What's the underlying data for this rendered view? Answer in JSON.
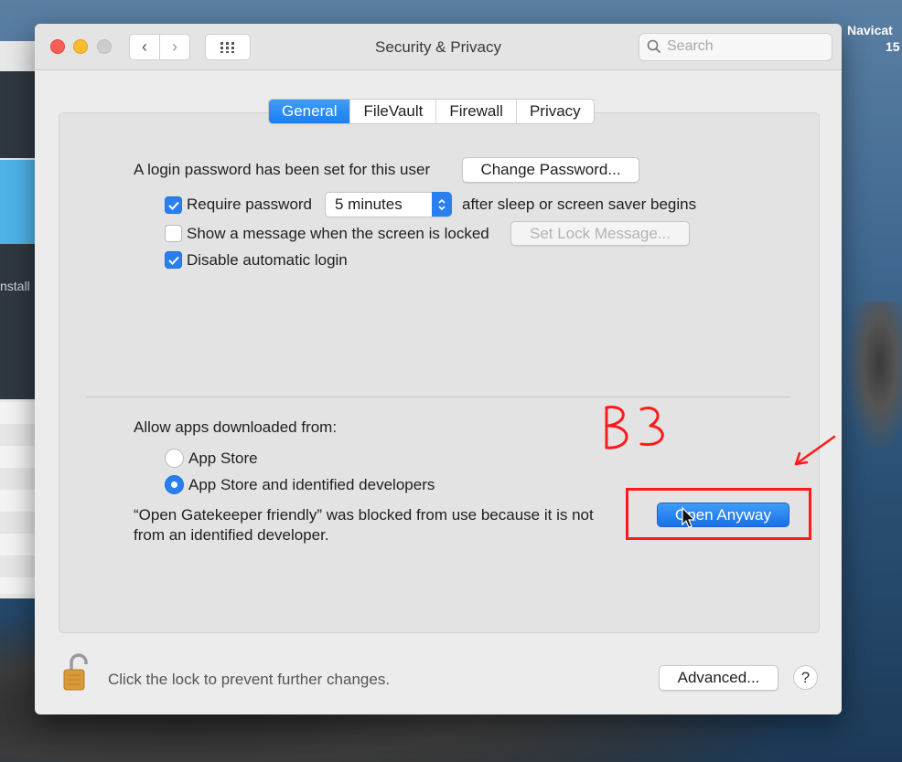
{
  "desktop": {
    "side_app_label": "nstall",
    "navicat_label": "Navicat",
    "navicat_number": "15"
  },
  "window": {
    "title": "Security & Privacy",
    "search_placeholder": "Search"
  },
  "tabs": [
    {
      "label": "General",
      "active": true
    },
    {
      "label": "FileVault",
      "active": false
    },
    {
      "label": "Firewall",
      "active": false
    },
    {
      "label": "Privacy",
      "active": false
    }
  ],
  "general": {
    "login_password_text": "A login password has been set for this user",
    "change_password_button": "Change Password...",
    "require_password_label": "Require password",
    "require_password_checked": true,
    "require_password_delay": "5 minutes",
    "after_sleep_text": "after sleep or screen saver begins",
    "show_message_label": "Show a message when the screen is locked",
    "show_message_checked": false,
    "set_lock_message_button": "Set Lock Message...",
    "disable_auto_login_label": "Disable automatic login",
    "disable_auto_login_checked": true
  },
  "gatekeeper": {
    "allow_apps_label": "Allow apps downloaded from:",
    "options": [
      {
        "label": "App Store",
        "selected": false
      },
      {
        "label": "App Store and identified developers",
        "selected": true
      }
    ],
    "blocked_message_line1": "“Open Gatekeeper friendly” was blocked from use because it is not",
    "blocked_message_line2": "from an identified developer.",
    "open_anyway_button": "Open Anyway"
  },
  "footer": {
    "lock_text": "Click the lock to prevent further changes.",
    "advanced_button": "Advanced...",
    "help_button": "?"
  },
  "annotation": {
    "handwritten_label": "B3",
    "color": "#ff1a1a"
  }
}
